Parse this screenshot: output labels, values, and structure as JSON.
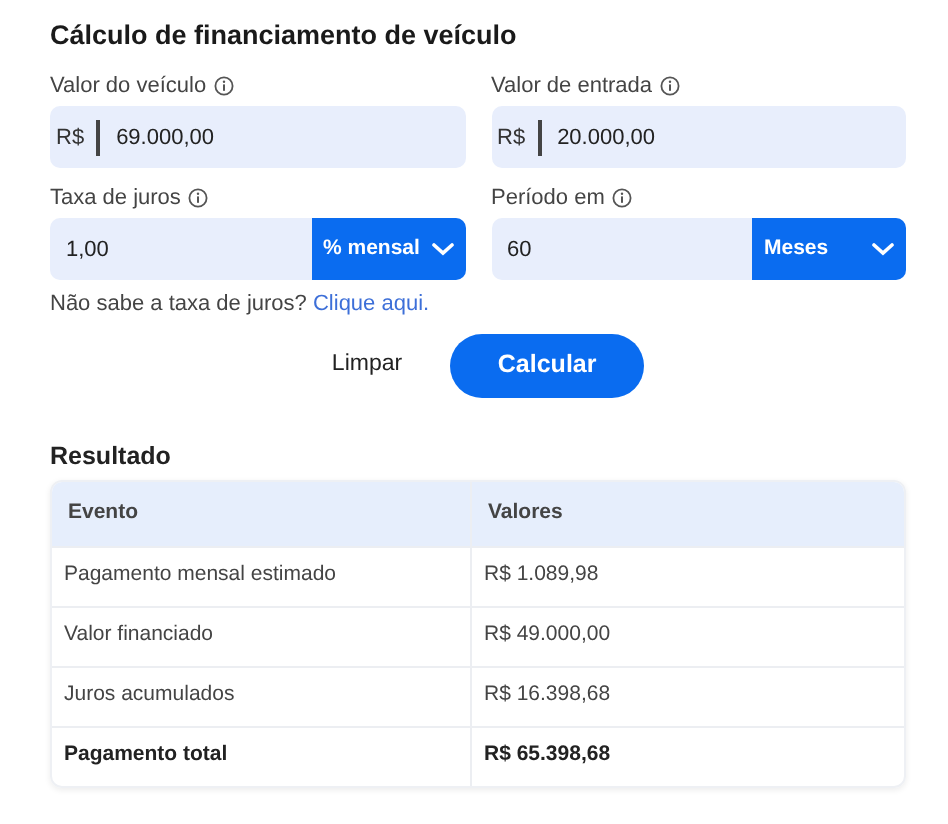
{
  "title": "Cálculo de financiamento de veículo",
  "fields": [
    {
      "label": "Valor do veículo",
      "prefix": "R$",
      "value": "69.000,00"
    },
    {
      "label": "Valor de entrada",
      "prefix": "R$",
      "value": "20.000,00"
    },
    {
      "label": "Taxa de juros",
      "value": "1,00",
      "unit": "% mensal"
    },
    {
      "label": "Período em",
      "value": "60",
      "unit": "Meses"
    }
  ],
  "hint": {
    "text": "Não sabe a taxa de juros?",
    "link": "Clique aqui."
  },
  "buttons": {
    "clear": "Limpar",
    "submit": "Calcular"
  },
  "result": {
    "title": "Resultado",
    "columns": [
      "Evento",
      "Valores"
    ],
    "rows": [
      {
        "kind": "item",
        "cells": [
          "Pagamento mensal estimado",
          "R$ 1.089,98"
        ]
      },
      {
        "kind": "item",
        "cells": [
          "Valor financiado",
          "R$ 49.000,00"
        ]
      },
      {
        "kind": "item",
        "cells": [
          "Juros acumulados",
          "R$ 16.398,68"
        ]
      },
      {
        "kind": "total",
        "cells": [
          "Pagamento total",
          "R$ 65.398,68"
        ]
      }
    ]
  }
}
